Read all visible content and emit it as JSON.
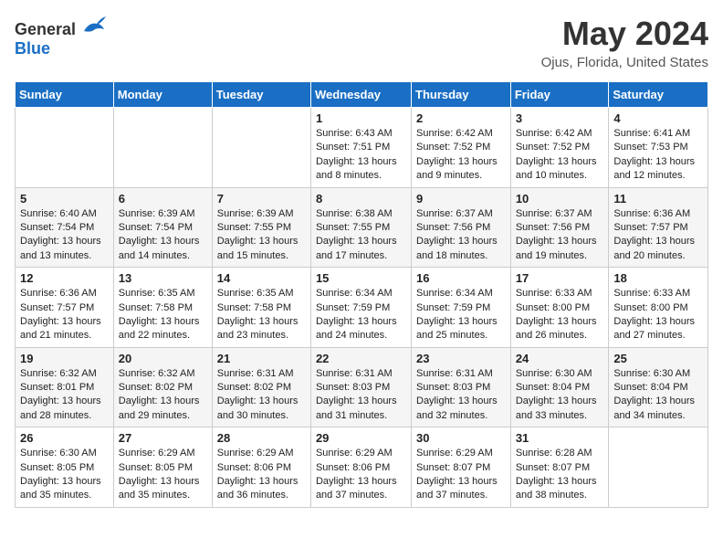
{
  "header": {
    "logo_general": "General",
    "logo_blue": "Blue",
    "title": "May 2024",
    "location": "Ojus, Florida, United States"
  },
  "weekdays": [
    "Sunday",
    "Monday",
    "Tuesday",
    "Wednesday",
    "Thursday",
    "Friday",
    "Saturday"
  ],
  "weeks": [
    [
      {
        "day": "",
        "info": ""
      },
      {
        "day": "",
        "info": ""
      },
      {
        "day": "",
        "info": ""
      },
      {
        "day": "1",
        "info": "Sunrise: 6:43 AM\nSunset: 7:51 PM\nDaylight: 13 hours\nand 8 minutes."
      },
      {
        "day": "2",
        "info": "Sunrise: 6:42 AM\nSunset: 7:52 PM\nDaylight: 13 hours\nand 9 minutes."
      },
      {
        "day": "3",
        "info": "Sunrise: 6:42 AM\nSunset: 7:52 PM\nDaylight: 13 hours\nand 10 minutes."
      },
      {
        "day": "4",
        "info": "Sunrise: 6:41 AM\nSunset: 7:53 PM\nDaylight: 13 hours\nand 12 minutes."
      }
    ],
    [
      {
        "day": "5",
        "info": "Sunrise: 6:40 AM\nSunset: 7:54 PM\nDaylight: 13 hours\nand 13 minutes."
      },
      {
        "day": "6",
        "info": "Sunrise: 6:39 AM\nSunset: 7:54 PM\nDaylight: 13 hours\nand 14 minutes."
      },
      {
        "day": "7",
        "info": "Sunrise: 6:39 AM\nSunset: 7:55 PM\nDaylight: 13 hours\nand 15 minutes."
      },
      {
        "day": "8",
        "info": "Sunrise: 6:38 AM\nSunset: 7:55 PM\nDaylight: 13 hours\nand 17 minutes."
      },
      {
        "day": "9",
        "info": "Sunrise: 6:37 AM\nSunset: 7:56 PM\nDaylight: 13 hours\nand 18 minutes."
      },
      {
        "day": "10",
        "info": "Sunrise: 6:37 AM\nSunset: 7:56 PM\nDaylight: 13 hours\nand 19 minutes."
      },
      {
        "day": "11",
        "info": "Sunrise: 6:36 AM\nSunset: 7:57 PM\nDaylight: 13 hours\nand 20 minutes."
      }
    ],
    [
      {
        "day": "12",
        "info": "Sunrise: 6:36 AM\nSunset: 7:57 PM\nDaylight: 13 hours\nand 21 minutes."
      },
      {
        "day": "13",
        "info": "Sunrise: 6:35 AM\nSunset: 7:58 PM\nDaylight: 13 hours\nand 22 minutes."
      },
      {
        "day": "14",
        "info": "Sunrise: 6:35 AM\nSunset: 7:58 PM\nDaylight: 13 hours\nand 23 minutes."
      },
      {
        "day": "15",
        "info": "Sunrise: 6:34 AM\nSunset: 7:59 PM\nDaylight: 13 hours\nand 24 minutes."
      },
      {
        "day": "16",
        "info": "Sunrise: 6:34 AM\nSunset: 7:59 PM\nDaylight: 13 hours\nand 25 minutes."
      },
      {
        "day": "17",
        "info": "Sunrise: 6:33 AM\nSunset: 8:00 PM\nDaylight: 13 hours\nand 26 minutes."
      },
      {
        "day": "18",
        "info": "Sunrise: 6:33 AM\nSunset: 8:00 PM\nDaylight: 13 hours\nand 27 minutes."
      }
    ],
    [
      {
        "day": "19",
        "info": "Sunrise: 6:32 AM\nSunset: 8:01 PM\nDaylight: 13 hours\nand 28 minutes."
      },
      {
        "day": "20",
        "info": "Sunrise: 6:32 AM\nSunset: 8:02 PM\nDaylight: 13 hours\nand 29 minutes."
      },
      {
        "day": "21",
        "info": "Sunrise: 6:31 AM\nSunset: 8:02 PM\nDaylight: 13 hours\nand 30 minutes."
      },
      {
        "day": "22",
        "info": "Sunrise: 6:31 AM\nSunset: 8:03 PM\nDaylight: 13 hours\nand 31 minutes."
      },
      {
        "day": "23",
        "info": "Sunrise: 6:31 AM\nSunset: 8:03 PM\nDaylight: 13 hours\nand 32 minutes."
      },
      {
        "day": "24",
        "info": "Sunrise: 6:30 AM\nSunset: 8:04 PM\nDaylight: 13 hours\nand 33 minutes."
      },
      {
        "day": "25",
        "info": "Sunrise: 6:30 AM\nSunset: 8:04 PM\nDaylight: 13 hours\nand 34 minutes."
      }
    ],
    [
      {
        "day": "26",
        "info": "Sunrise: 6:30 AM\nSunset: 8:05 PM\nDaylight: 13 hours\nand 35 minutes."
      },
      {
        "day": "27",
        "info": "Sunrise: 6:29 AM\nSunset: 8:05 PM\nDaylight: 13 hours\nand 35 minutes."
      },
      {
        "day": "28",
        "info": "Sunrise: 6:29 AM\nSunset: 8:06 PM\nDaylight: 13 hours\nand 36 minutes."
      },
      {
        "day": "29",
        "info": "Sunrise: 6:29 AM\nSunset: 8:06 PM\nDaylight: 13 hours\nand 37 minutes."
      },
      {
        "day": "30",
        "info": "Sunrise: 6:29 AM\nSunset: 8:07 PM\nDaylight: 13 hours\nand 37 minutes."
      },
      {
        "day": "31",
        "info": "Sunrise: 6:28 AM\nSunset: 8:07 PM\nDaylight: 13 hours\nand 38 minutes."
      },
      {
        "day": "",
        "info": ""
      }
    ]
  ]
}
